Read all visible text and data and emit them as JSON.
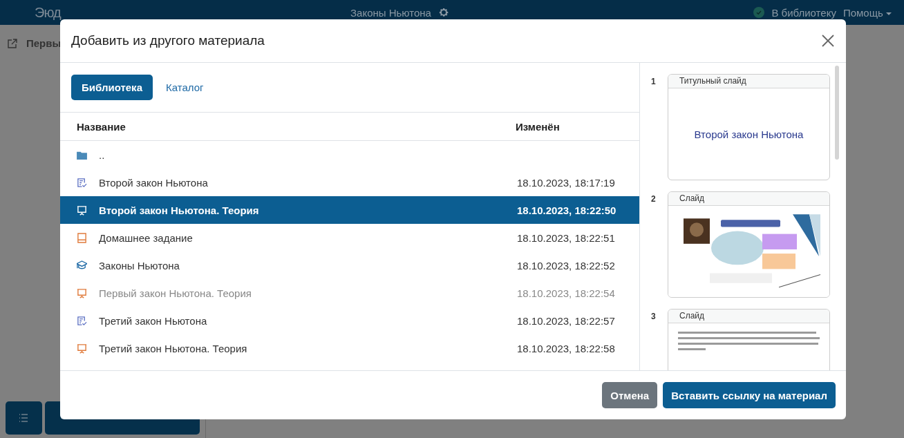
{
  "app_bar": {
    "logo": "Эюд",
    "title": "Законы Ньютона",
    "saved_link": "В библиотеку",
    "help_menu": "Помощь"
  },
  "side_panel": {
    "heading": "Первы"
  },
  "dialog": {
    "title": "Добавить из другого материала",
    "tabs": [
      {
        "label": "Библиотека",
        "selected": true
      },
      {
        "label": "Каталог",
        "selected": false
      }
    ],
    "columns": [
      "Название",
      "Изменён"
    ],
    "rows": [
      {
        "kind": "folder",
        "name": "..",
        "modified": "",
        "selected": false,
        "disabled": false
      },
      {
        "kind": "test",
        "name": "Второй закон Ньютона",
        "modified": "18.10.2023, 18:17:19",
        "selected": false,
        "disabled": false
      },
      {
        "kind": "presentation",
        "name": "Второй закон Ньютона. Теория",
        "modified": "18.10.2023, 18:22:50",
        "selected": true,
        "disabled": false
      },
      {
        "kind": "book",
        "name": "Домашнее задание",
        "modified": "18.10.2023, 18:22:51",
        "selected": false,
        "disabled": false
      },
      {
        "kind": "course",
        "name": "Законы Ньютона",
        "modified": "18.10.2023, 18:22:52",
        "selected": false,
        "disabled": false
      },
      {
        "kind": "presentation",
        "name": "Первый закон Ньютона. Теория",
        "modified": "18.10.2023, 18:22:54",
        "selected": false,
        "disabled": true
      },
      {
        "kind": "test",
        "name": "Третий закон Ньютона",
        "modified": "18.10.2023, 18:22:57",
        "selected": false,
        "disabled": false
      },
      {
        "kind": "presentation",
        "name": "Третий закон Ньютона. Теория",
        "modified": "18.10.2023, 18:22:58",
        "selected": false,
        "disabled": false
      }
    ],
    "slides": [
      {
        "number": "1",
        "label": "Титульный слайд",
        "kind": "title",
        "heading": "Второй закон Ньютона"
      },
      {
        "number": "2",
        "label": "Слайд",
        "kind": "picture"
      },
      {
        "number": "3",
        "label": "Слайд",
        "kind": "text"
      }
    ],
    "buttons": {
      "cancel": "Отмена",
      "confirm": "Вставить ссылку на материал"
    }
  }
}
